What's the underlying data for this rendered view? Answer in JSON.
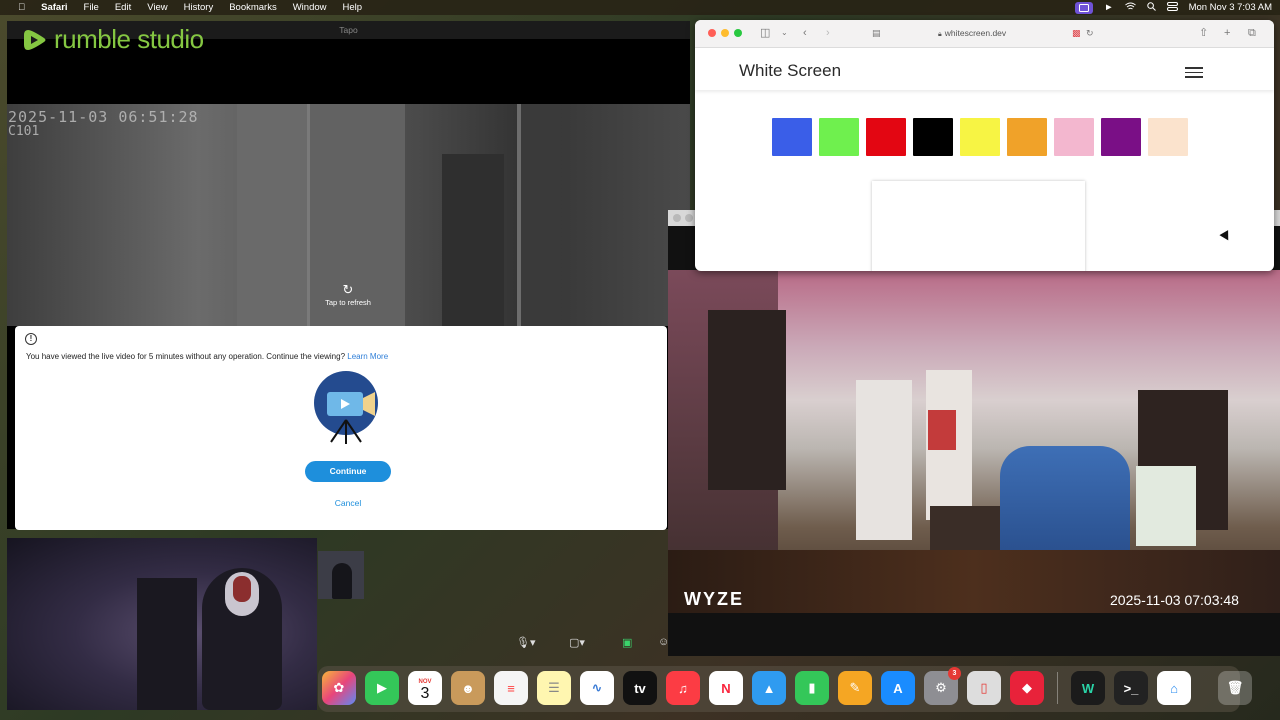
{
  "menubar": {
    "app": "Safari",
    "items": [
      "File",
      "Edit",
      "View",
      "History",
      "Bookmarks",
      "Window",
      "Help"
    ],
    "clock": "Mon Nov 3  7:03 AM"
  },
  "tapo": {
    "window_title": "Tapo",
    "brand_name": "rumble",
    "brand_suffix": "studio",
    "camera_timestamp": "2025-11-03 06:51:28",
    "camera_id": "C101",
    "refresh_label": "Tap to refresh",
    "dialog": {
      "message": "You have viewed the live video for 5 minutes without any operation. Continue the viewing?",
      "learn_more": "Learn More",
      "continue": "Continue",
      "cancel": "Cancel"
    }
  },
  "safari": {
    "url": "whitescreen.dev",
    "page_title": "White Screen",
    "swatch_colors": [
      "#3a5ee8",
      "#6ff04e",
      "#e30612",
      "#000000",
      "#f7f444",
      "#f0a229",
      "#f3b7cf",
      "#7a0f86",
      "#fbe3cd"
    ]
  },
  "wyze": {
    "logo": "WYZE",
    "timestamp": "2025-11-03  07:03:48"
  },
  "dock": {
    "calendar_month": "NOV",
    "calendar_day": "3",
    "settings_badge": "3",
    "apple_tv_label": "tv"
  }
}
